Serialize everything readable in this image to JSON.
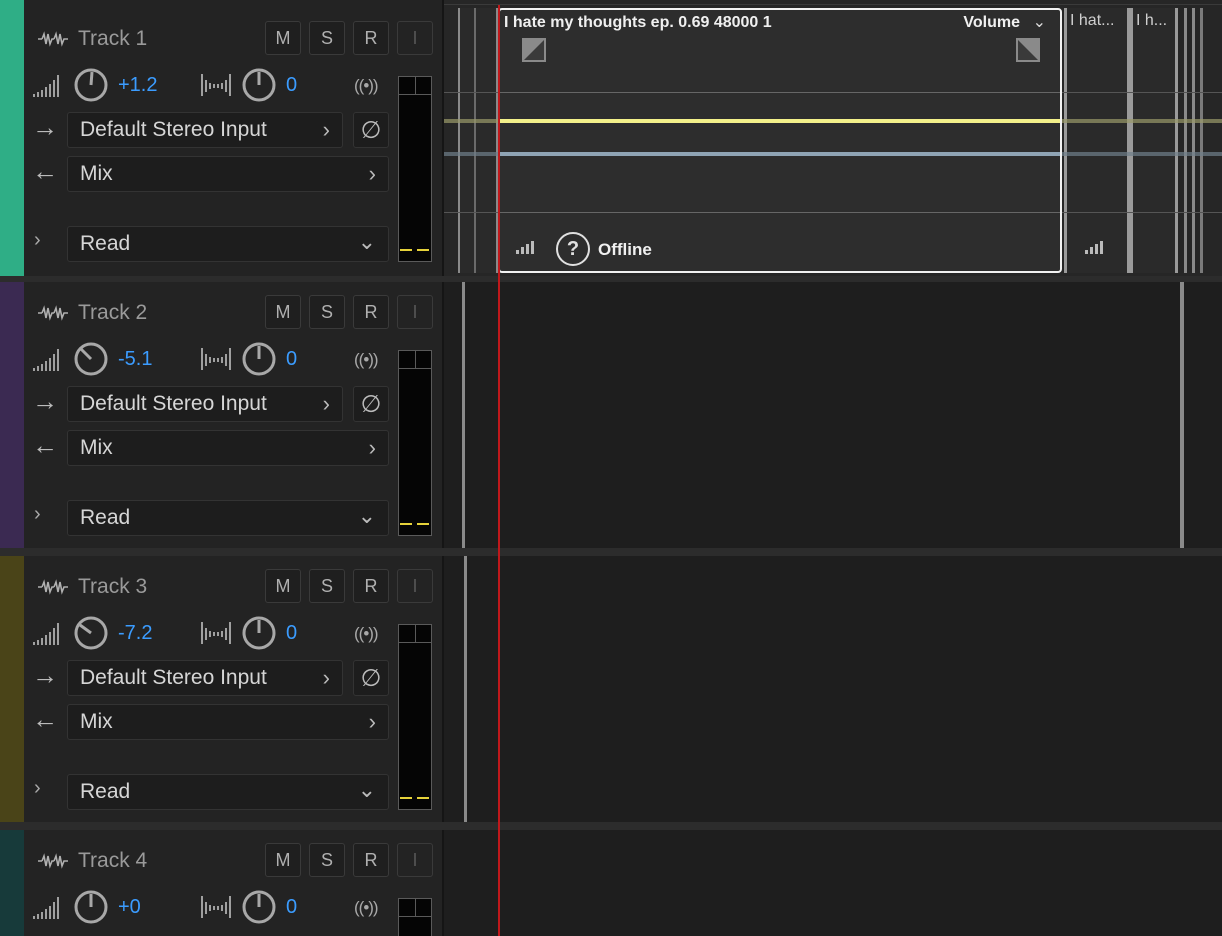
{
  "tracks": [
    {
      "name": "Track 1",
      "volume": "+1.2",
      "pan": "0",
      "input": "Default Stereo Input",
      "output": "Mix",
      "automation": "Read",
      "color": "#2fae86"
    },
    {
      "name": "Track 2",
      "volume": "-5.1",
      "pan": "0",
      "input": "Default Stereo Input",
      "output": "Mix",
      "automation": "Read",
      "color": "#3b2a52"
    },
    {
      "name": "Track 3",
      "volume": "-7.2",
      "pan": "0",
      "input": "Default Stereo Input",
      "output": "Mix",
      "automation": "Read",
      "color": "#4a4418"
    },
    {
      "name": "Track 4",
      "volume": "+0",
      "pan": "0",
      "input": "",
      "output": "",
      "automation": "",
      "color": "#173a3a"
    }
  ],
  "buttons": {
    "mute": "M",
    "solo": "S",
    "record": "R",
    "input_monitor": "I"
  },
  "clip": {
    "title": "I hate my thoughts ep. 0.69 48000 1",
    "effect": "Volume",
    "status": "Offline",
    "short_clip_1": "I hat...",
    "short_clip_2": "I h..."
  },
  "colors": {
    "volume_line": "#f3f08a",
    "pan_line": "#8fa4b4",
    "playhead": "#c0181b",
    "knob_value": "#3b9cff",
    "meter_peak": "#e6d23a"
  }
}
